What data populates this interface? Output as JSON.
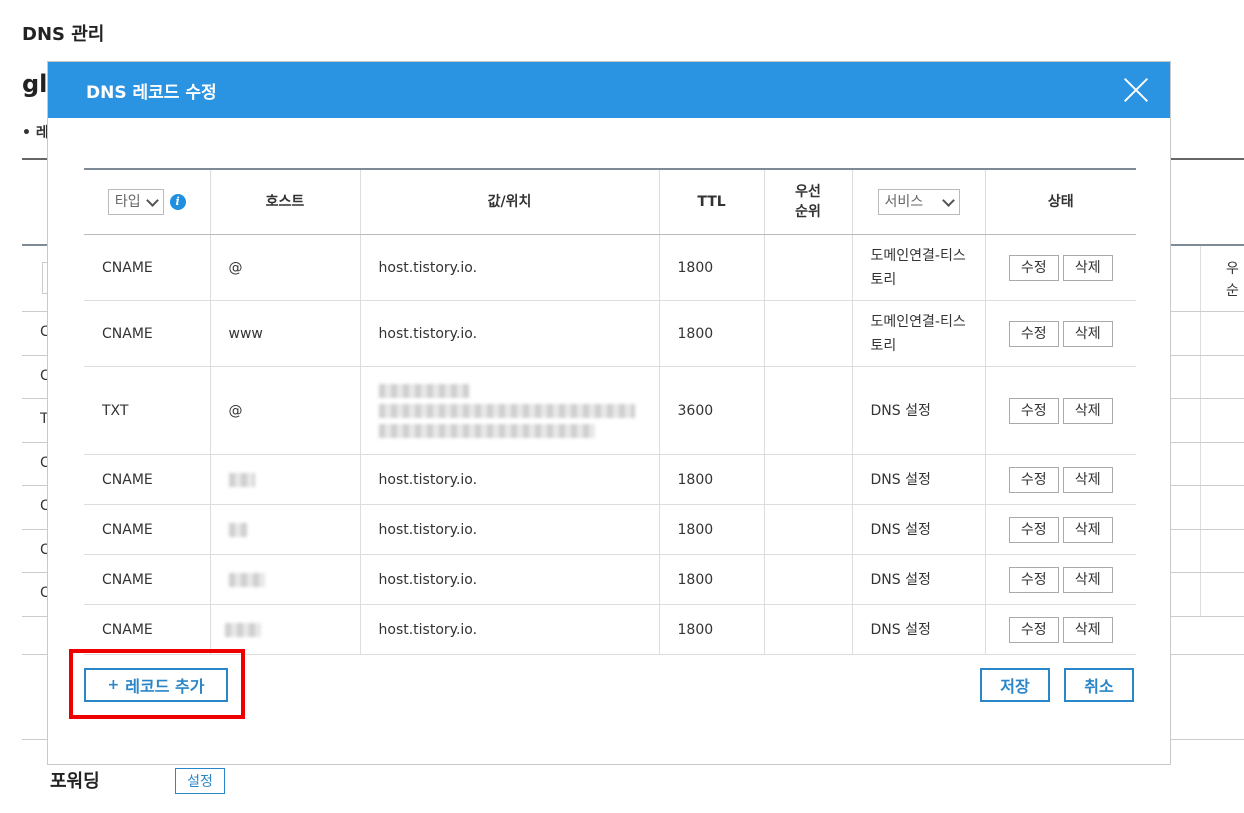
{
  "page": {
    "title": "DNS 관리",
    "heading_partial": "gl",
    "bullet_partial": "• 레",
    "bg_right_col": [
      "우",
      "순"
    ],
    "bg_rows": [
      "C",
      "C",
      "T",
      "C",
      "C",
      "C",
      "C"
    ]
  },
  "forwarding": {
    "label": "포워딩",
    "button": "설정"
  },
  "modal": {
    "title": "DNS 레코드 수정",
    "table": {
      "type_select": "타입",
      "headers": {
        "host": "호스트",
        "value": "값/위치",
        "ttl": "TTL",
        "priority": "우선\n순위",
        "service_select": "서비스",
        "status": "상태"
      },
      "rows": [
        {
          "type": "CNAME",
          "host": "@",
          "value": "host.tistory.io.",
          "ttl": "1800",
          "priority": "",
          "service": "도메인연결-티스토리"
        },
        {
          "type": "CNAME",
          "host": "www",
          "value": "host.tistory.io.",
          "ttl": "1800",
          "priority": "",
          "service": "도메인연결-티스토리"
        },
        {
          "type": "TXT",
          "host": "@",
          "value": "",
          "ttl": "3600",
          "priority": "",
          "service": "DNS 설정"
        },
        {
          "type": "CNAME",
          "host": "",
          "value": "host.tistory.io.",
          "ttl": "1800",
          "priority": "",
          "service": "DNS 설정"
        },
        {
          "type": "CNAME",
          "host": "",
          "value": "host.tistory.io.",
          "ttl": "1800",
          "priority": "",
          "service": "DNS 설정"
        },
        {
          "type": "CNAME",
          "host": "",
          "value": "host.tistory.io.",
          "ttl": "1800",
          "priority": "",
          "service": "DNS 설정"
        },
        {
          "type": "CNAME",
          "host": "",
          "value": "host.tistory.io.",
          "ttl": "1800",
          "priority": "",
          "service": "DNS 설정"
        }
      ],
      "edit_label": "수정",
      "delete_label": "삭제"
    },
    "add_record": "레코드 추가",
    "add_icon": "+",
    "save": "저장",
    "cancel": "취소"
  },
  "colors": {
    "header": "#2a93e2",
    "accent": "#2a86c8",
    "highlight": "#ee0000"
  },
  "icons": {
    "info": "info-icon",
    "close": "close-icon",
    "chevron": "chevron-down-icon"
  }
}
